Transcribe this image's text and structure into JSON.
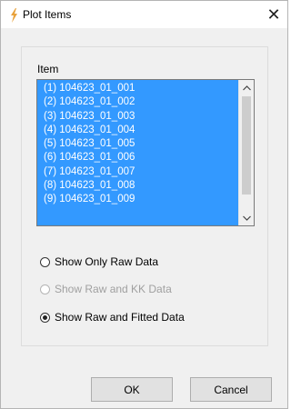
{
  "window": {
    "title": "Plot Items",
    "close_glyph": "✕"
  },
  "group": {
    "item_label": "Item",
    "items": [
      "(1) 104623_01_001",
      "(2) 104623_01_002",
      "(3) 104623_01_003",
      "(4) 104623_01_004",
      "(5) 104623_01_005",
      "(6) 104623_01_006",
      "(7) 104623_01_007",
      "(8) 104623_01_008",
      "(9) 104623_01_009"
    ],
    "radios": [
      {
        "label": "Show Only Raw Data",
        "checked": false,
        "disabled": false
      },
      {
        "label": "Show Raw and KK Data",
        "checked": false,
        "disabled": true
      },
      {
        "label": "Show Raw and Fitted Data",
        "checked": true,
        "disabled": false
      }
    ]
  },
  "buttons": {
    "ok": "OK",
    "cancel": "Cancel"
  },
  "icons": {
    "app": "plot-items-app-icon",
    "scroll_up": "chevron-up-icon",
    "scroll_down": "chevron-down-icon"
  },
  "colors": {
    "selection": "#3399ff",
    "accent": "#e8a23c"
  }
}
